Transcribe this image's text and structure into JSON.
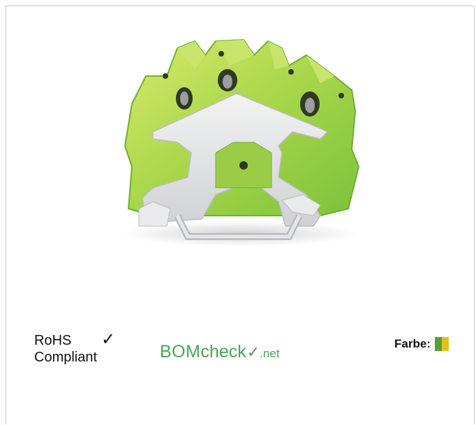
{
  "product": {
    "image_icon": "terminal-block-icon"
  },
  "badges": {
    "rohs_line1": "RoHS",
    "rohs_line2": "Compliant",
    "rohs_check": "✓",
    "bomcheck_bom": "BOM",
    "bomcheck_check": "check",
    "bomcheck_mark": "✓",
    "bomcheck_net": ".net",
    "bomcheck_color": "#4aa35a"
  },
  "color_info": {
    "label": "Farbe:",
    "swatch_colors": [
      "#5c9e2e",
      "#e2c21a"
    ]
  }
}
